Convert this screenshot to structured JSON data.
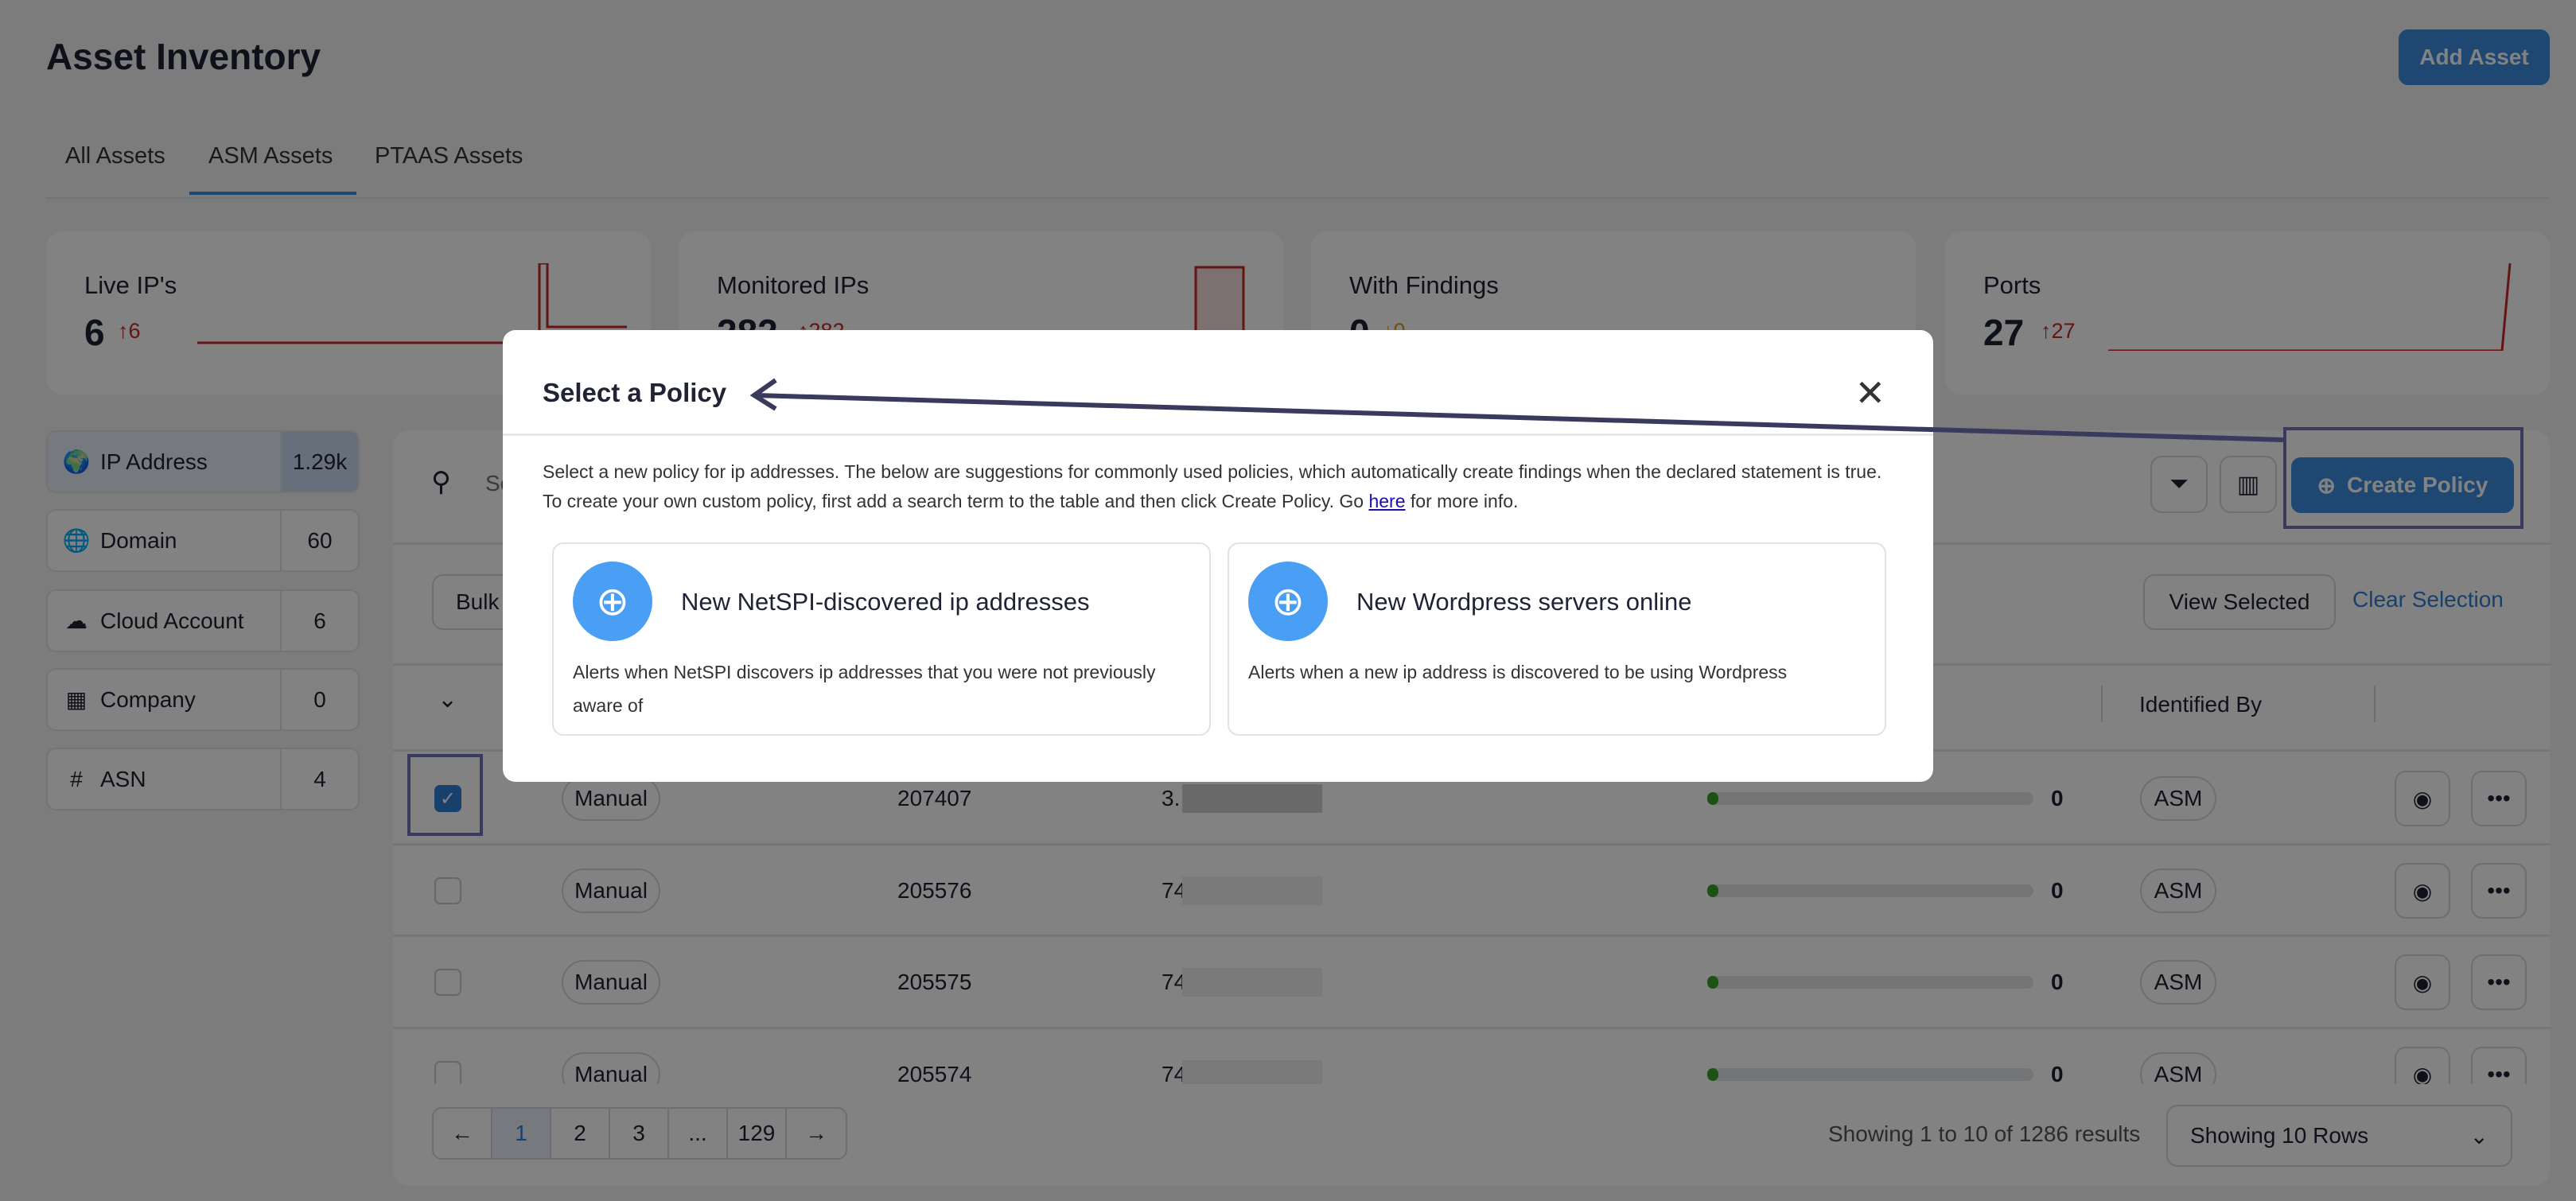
{
  "header": {
    "title": "Asset Inventory",
    "add_asset": "Add Asset"
  },
  "tabs": [
    {
      "label": "All Assets"
    },
    {
      "label": "ASM Assets",
      "active": true
    },
    {
      "label": "PTAAS Assets"
    }
  ],
  "stats": [
    {
      "label": "Live IP's",
      "value": "6",
      "delta": "6"
    },
    {
      "label": "Monitored IPs",
      "value": "282",
      "delta": "282"
    },
    {
      "label": "With Findings",
      "value": "0",
      "delta": "0"
    },
    {
      "label": "Ports",
      "value": "27",
      "delta": "27"
    }
  ],
  "sidebar": [
    {
      "label": "IP Address",
      "count": "1.29k",
      "icon": "globe-pin-icon",
      "active": true
    },
    {
      "label": "Domain",
      "count": "60",
      "icon": "globe-icon"
    },
    {
      "label": "Cloud Account",
      "count": "6",
      "icon": "cloud-icon"
    },
    {
      "label": "Company",
      "count": "0",
      "icon": "building-icon"
    },
    {
      "label": "ASN",
      "count": "4",
      "icon": "hash-icon"
    }
  ],
  "toolbar": {
    "search_placeholder": "Search",
    "create_policy": "Create Policy",
    "bulk": "Bulk",
    "view_selected": "View Selected",
    "clear_selection": "Clear Selection"
  },
  "table": {
    "headers": {
      "identified_by": "Identified By"
    },
    "rows": [
      {
        "type": "Manual",
        "id": "207407",
        "ip": "3.",
        "count": "0",
        "source": "ASM",
        "checked": true
      },
      {
        "type": "Manual",
        "id": "205576",
        "ip": "74.",
        "count": "0",
        "source": "ASM"
      },
      {
        "type": "Manual",
        "id": "205575",
        "ip": "74.",
        "count": "0",
        "source": "ASM"
      },
      {
        "type": "Manual",
        "id": "205574",
        "ip": "74.",
        "count": "0",
        "source": "ASM"
      }
    ]
  },
  "pagination": {
    "pages": [
      "1",
      "2",
      "3",
      "...",
      "129"
    ],
    "current": "1",
    "summary": "Showing 1 to 10 of 1286 results",
    "rows_select": "Showing 10 Rows"
  },
  "modal": {
    "title": "Select a Policy",
    "desc_before": "Select a new policy for ip addresses. The below are suggestions for commonly used policies, which automatically create findings when the declared statement is true. To create your own custom policy, first add a search term to the table and then click Create Policy. Go ",
    "desc_link": "here",
    "desc_after": " for more info.",
    "policies": [
      {
        "title": "New NetSPI-discovered ip addresses",
        "desc": "Alerts when NetSPI discovers ip addresses that you were not previously aware of"
      },
      {
        "title": "New Wordpress servers online",
        "desc": "Alerts when a new ip address is discovered to be using Wordpress"
      }
    ]
  },
  "colors": {
    "accent": "#3b8ee0",
    "policy_icon": "#4a9ff5",
    "delta_up": "#c62828",
    "annotation": "#3a3a5c"
  }
}
